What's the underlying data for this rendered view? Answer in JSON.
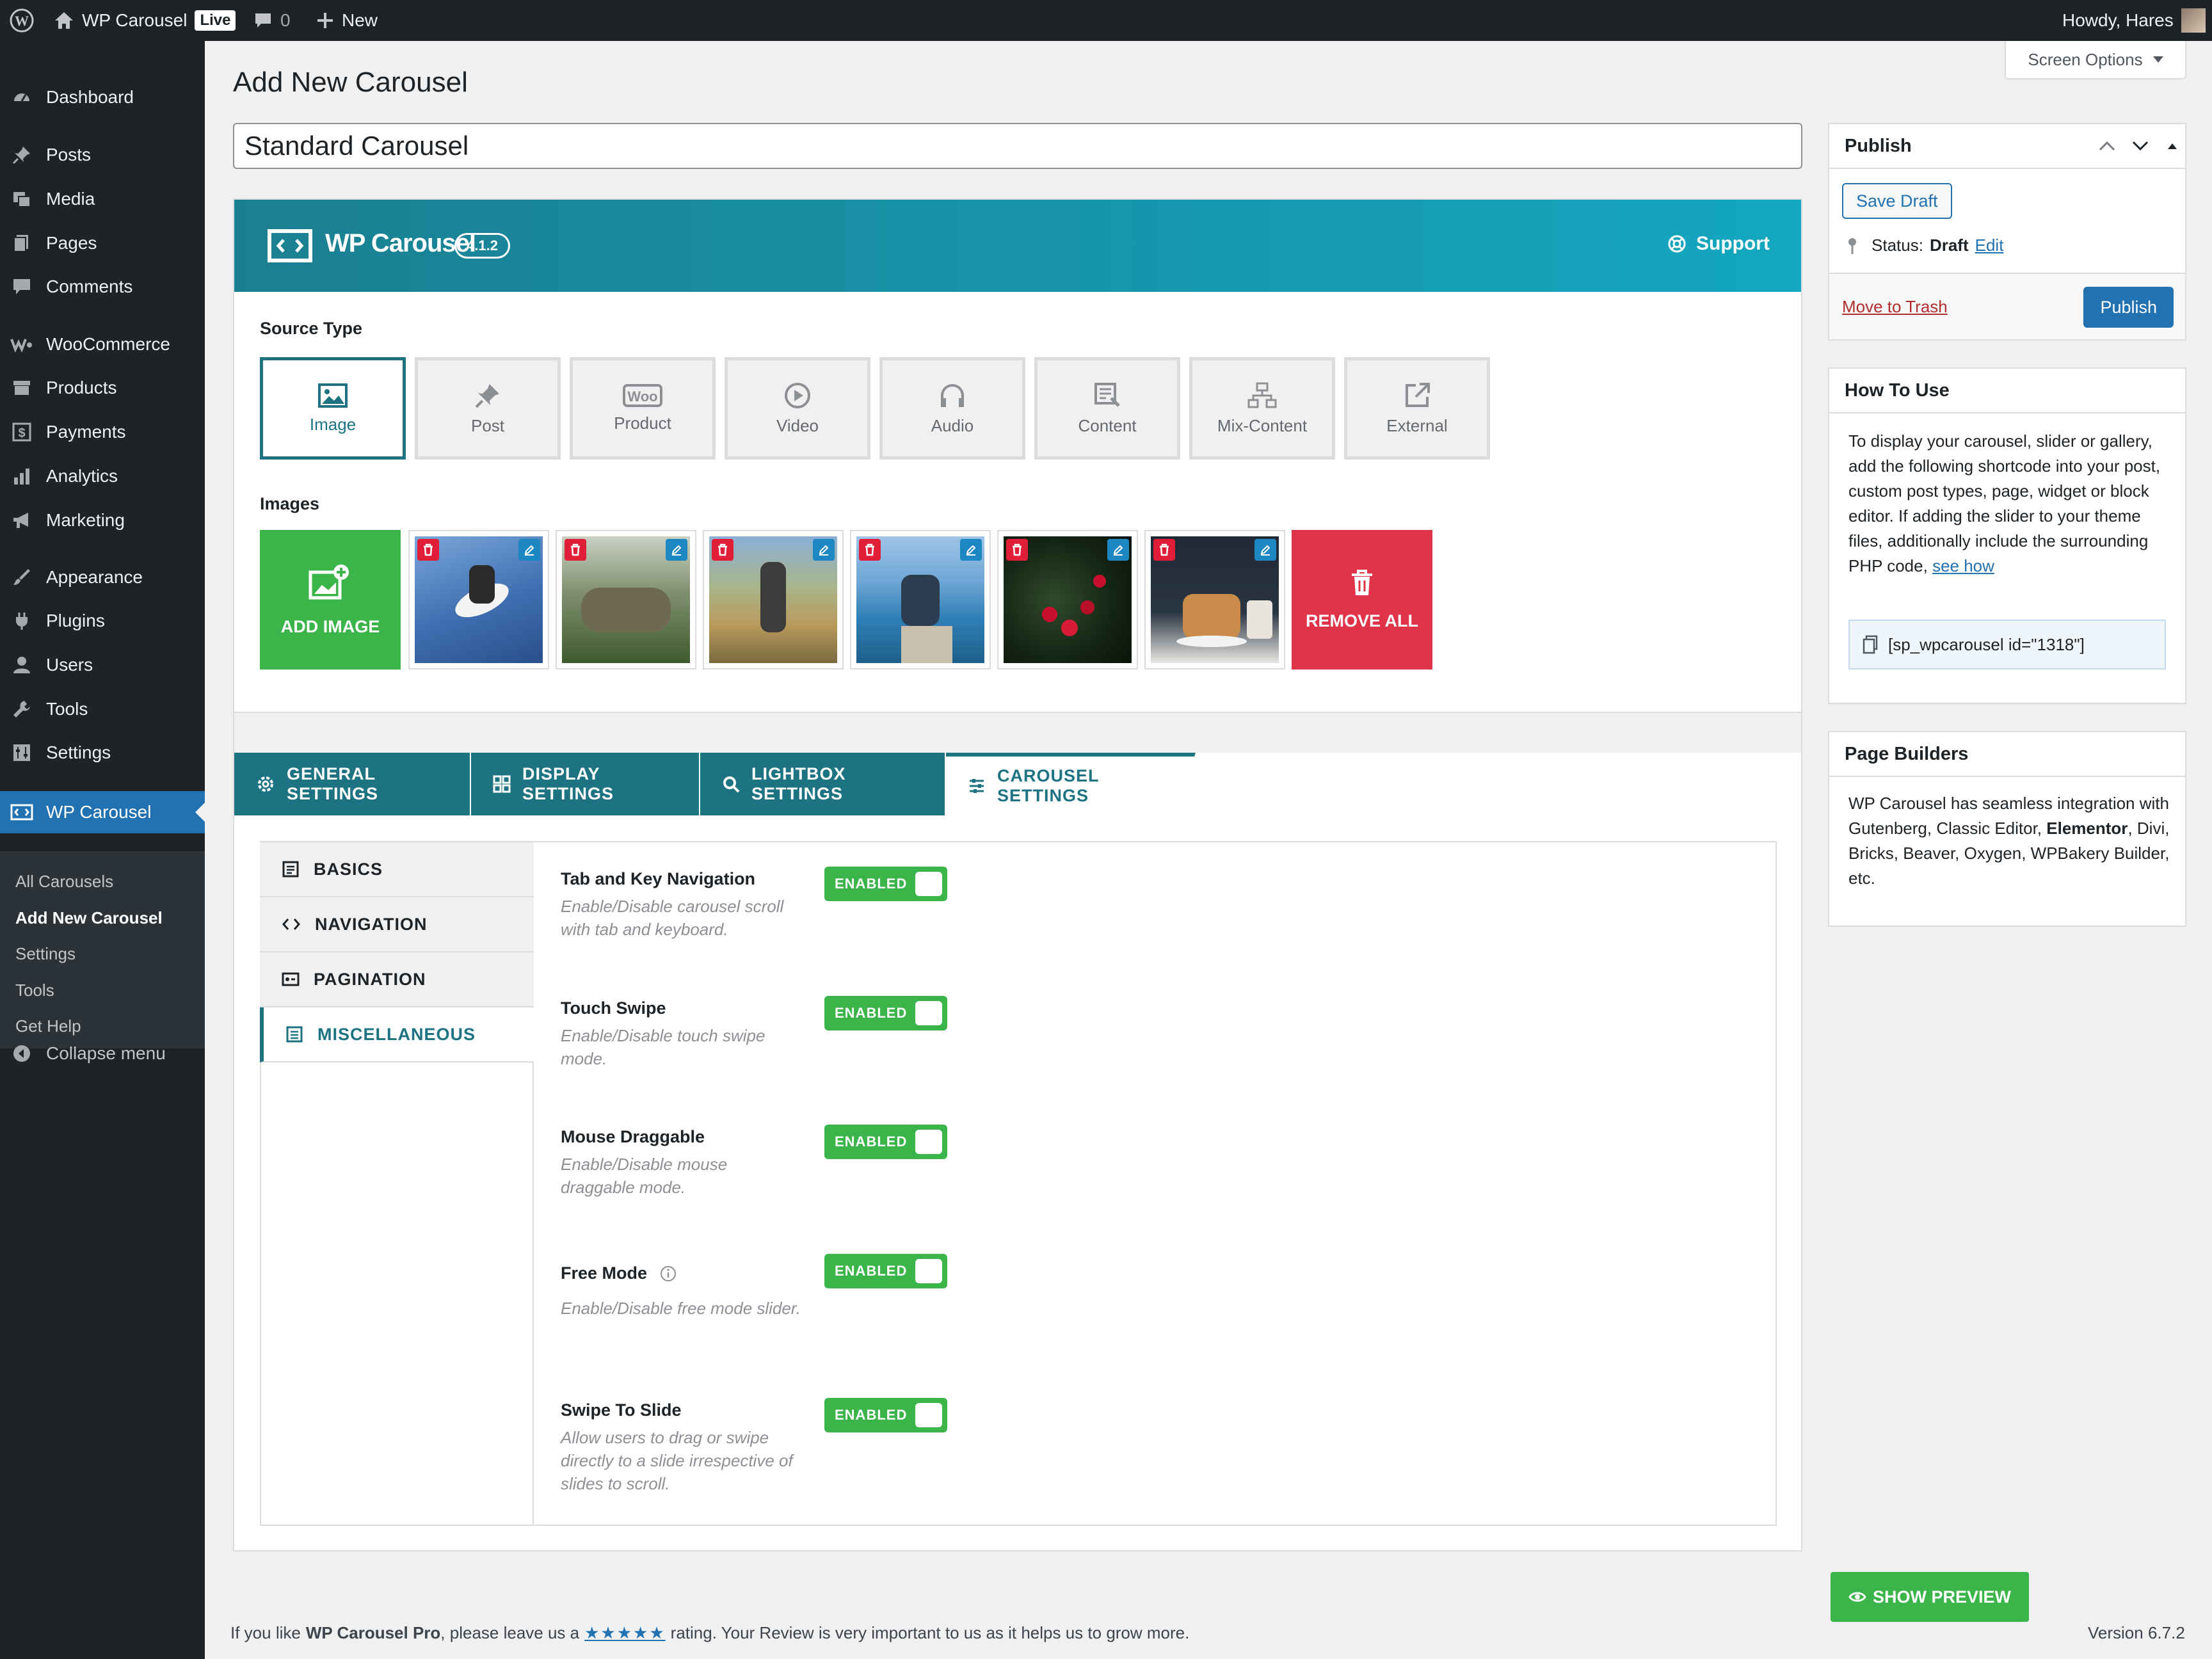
{
  "adminbar": {
    "site_name": "WP Carousel",
    "live_badge": "Live",
    "comments_count": "0",
    "new_label": "New",
    "howdy": "Howdy, Hares"
  },
  "sidebar": {
    "items": [
      {
        "label": "Dashboard",
        "icon": "dashboard-icon"
      },
      {
        "label": "Posts",
        "icon": "pin-icon"
      },
      {
        "label": "Media",
        "icon": "media-icon"
      },
      {
        "label": "Pages",
        "icon": "pages-icon"
      },
      {
        "label": "Comments",
        "icon": "comment-icon"
      },
      {
        "label": "WooCommerce",
        "icon": "woo-icon"
      },
      {
        "label": "Products",
        "icon": "archive-icon"
      },
      {
        "label": "Payments",
        "icon": "dollar-icon"
      },
      {
        "label": "Analytics",
        "icon": "chart-icon"
      },
      {
        "label": "Marketing",
        "icon": "megaphone-icon"
      },
      {
        "label": "Appearance",
        "icon": "brush-icon"
      },
      {
        "label": "Plugins",
        "icon": "plug-icon"
      },
      {
        "label": "Users",
        "icon": "user-icon"
      },
      {
        "label": "Tools",
        "icon": "wrench-icon"
      },
      {
        "label": "Settings",
        "icon": "settings-icon"
      },
      {
        "label": "WP Carousel",
        "icon": "carousel-icon"
      }
    ],
    "submenu": [
      "All Carousels",
      "Add New Carousel",
      "Settings",
      "Tools",
      "Get Help"
    ],
    "collapse": "Collapse menu"
  },
  "screen_options": "Screen Options",
  "page_title": "Add New Carousel",
  "post_title": "Standard Carousel",
  "plugin": {
    "name": "WP Carousel",
    "version": "4.1.2",
    "support": "Support"
  },
  "source": {
    "label": "Source Type",
    "types": [
      "Image",
      "Post",
      "Product",
      "Video",
      "Audio",
      "Content",
      "Mix-Content",
      "External"
    ]
  },
  "images": {
    "label": "Images",
    "add": "ADD IMAGE",
    "remove_all": "REMOVE ALL"
  },
  "tabs": [
    "GENERAL SETTINGS",
    "DISPLAY SETTINGS",
    "LIGHTBOX SETTINGS",
    "CAROUSEL SETTINGS"
  ],
  "subtabs": [
    "BASICS",
    "NAVIGATION",
    "PAGINATION",
    "MISCELLANEOUS"
  ],
  "fields": [
    {
      "label": "Tab and Key Navigation",
      "desc": "Enable/Disable carousel scroll with tab and keyboard.",
      "state": "ENABLED"
    },
    {
      "label": "Touch Swipe",
      "desc": "Enable/Disable touch swipe mode.",
      "state": "ENABLED"
    },
    {
      "label": "Mouse Draggable",
      "desc": "Enable/Disable mouse draggable mode.",
      "state": "ENABLED"
    },
    {
      "label": "Free Mode",
      "desc": "Enable/Disable free mode slider.",
      "state": "ENABLED"
    },
    {
      "label": "Swipe To Slide",
      "desc": "Allow users to drag or swipe directly to a slide irrespective of slides to scroll.",
      "state": "ENABLED"
    }
  ],
  "publish": {
    "title": "Publish",
    "save_draft": "Save Draft",
    "status_label": "Status:",
    "status_value": "Draft",
    "edit": "Edit",
    "trash": "Move to Trash",
    "publish_btn": "Publish"
  },
  "howto": {
    "title": "How To Use",
    "text": "To display your carousel, slider or gallery, add the following shortcode into your post, custom post types, page, widget or block editor. If adding the slider to your theme files, additionally include the surrounding PHP code,",
    "link": "see how",
    "shortcode": "[sp_wpcarousel id=\"1318\"]"
  },
  "builders": {
    "title": "Page Builders",
    "text_before": "WP Carousel has seamless integration with Gutenberg, Classic Editor,",
    "bold": "Elementor",
    "text_after": ", Divi, Bricks, Beaver, Oxygen, WPBakery Builder, etc."
  },
  "preview": "SHOW PREVIEW",
  "footer": {
    "prefix": "If you like",
    "brand": "WP Carousel Pro",
    "mid": ", please leave us a",
    "stars": "★★★★★",
    "suffix": "rating. Your Review is very important to us as it helps us to grow more.",
    "version": "Version 6.7.2"
  },
  "colors": {
    "admin_dark": "#1d2327",
    "wp_blue": "#2271b1",
    "teal": "#1d7382",
    "green": "#3bb54a",
    "red": "#e01e37"
  }
}
